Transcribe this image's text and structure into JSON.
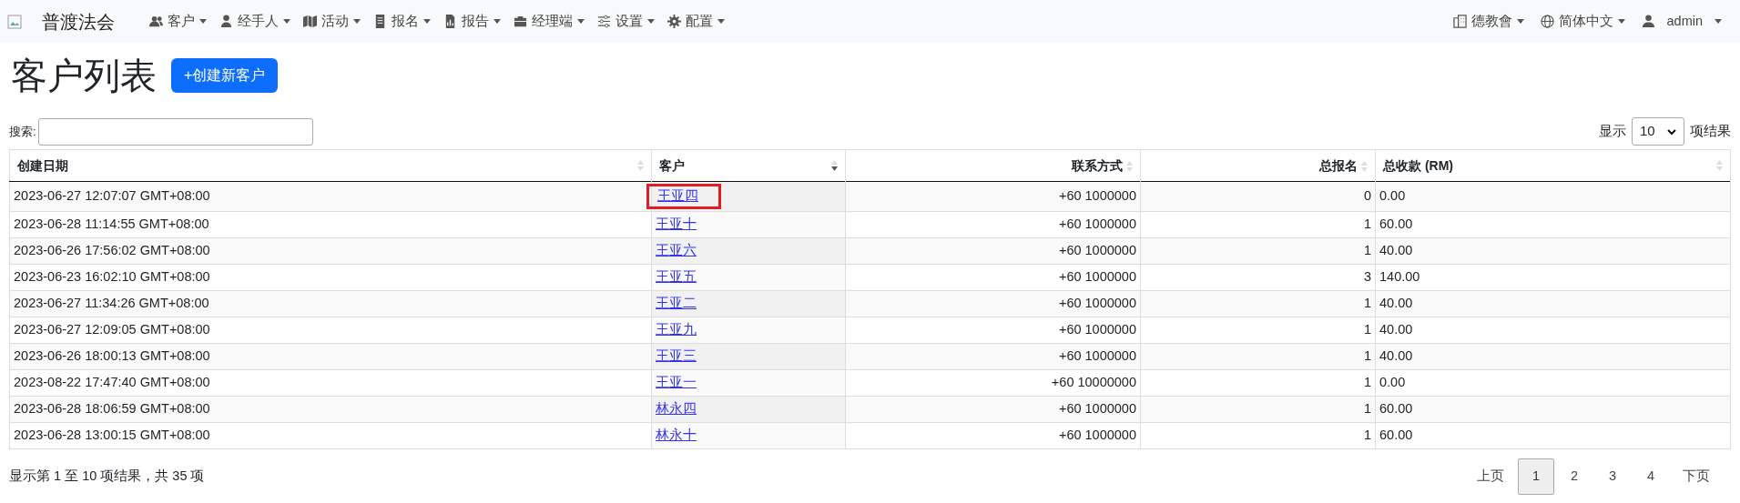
{
  "navbar": {
    "brand": "普渡法会",
    "menu": [
      {
        "label": "客户"
      },
      {
        "label": "经手人"
      },
      {
        "label": "活动"
      },
      {
        "label": "报名"
      },
      {
        "label": "报告"
      },
      {
        "label": "经理端"
      },
      {
        "label": "设置"
      },
      {
        "label": "配置"
      }
    ],
    "right": [
      {
        "label": "德教會"
      },
      {
        "label": "简体中文"
      },
      {
        "label": "admin"
      }
    ]
  },
  "page_title": "客户列表",
  "create_button": "+创建新客户",
  "search": {
    "label": "搜索:"
  },
  "length": {
    "before": "显示",
    "value": "10",
    "after": "项结果"
  },
  "table": {
    "columns": [
      {
        "label": "创建日期",
        "sorted": false
      },
      {
        "label": "客户",
        "sorted": true
      },
      {
        "label": "联系方式",
        "sorted": false
      },
      {
        "label": "总报名",
        "sorted": false
      },
      {
        "label": "总收款 (RM)",
        "sorted": false
      }
    ],
    "rows": [
      {
        "date": "2023-06-27 12:07:07 GMT+08:00",
        "customer": "王亚四",
        "contact": "+60 1000000",
        "signups": "0",
        "paid": "0.00",
        "highlighted": true
      },
      {
        "date": "2023-06-28 11:14:55 GMT+08:00",
        "customer": "王亚十",
        "contact": "+60 1000000",
        "signups": "1",
        "paid": "60.00",
        "highlighted": false
      },
      {
        "date": "2023-06-26 17:56:02 GMT+08:00",
        "customer": "王亚六",
        "contact": "+60 1000000",
        "signups": "1",
        "paid": "40.00",
        "highlighted": false
      },
      {
        "date": "2023-06-23 16:02:10 GMT+08:00",
        "customer": "王亚五",
        "contact": "+60 1000000",
        "signups": "3",
        "paid": "140.00",
        "highlighted": false
      },
      {
        "date": "2023-06-27 11:34:26 GMT+08:00",
        "customer": "王亚二",
        "contact": "+60 1000000",
        "signups": "1",
        "paid": "40.00",
        "highlighted": false
      },
      {
        "date": "2023-06-27 12:09:05 GMT+08:00",
        "customer": "王亚九",
        "contact": "+60 1000000",
        "signups": "1",
        "paid": "40.00",
        "highlighted": false
      },
      {
        "date": "2023-06-26 18:00:13 GMT+08:00",
        "customer": "王亚三",
        "contact": "+60 1000000",
        "signups": "1",
        "paid": "40.00",
        "highlighted": false
      },
      {
        "date": "2023-08-22 17:47:40 GMT+08:00",
        "customer": "王亚一",
        "contact": "+60 10000000",
        "signups": "1",
        "paid": "0.00",
        "highlighted": false
      },
      {
        "date": "2023-06-28 18:06:59 GMT+08:00",
        "customer": "林永四",
        "contact": "+60 1000000",
        "signups": "1",
        "paid": "60.00",
        "highlighted": false
      },
      {
        "date": "2023-06-28 13:00:15 GMT+08:00",
        "customer": "林永十",
        "contact": "+60 1000000",
        "signups": "1",
        "paid": "60.00",
        "highlighted": false
      }
    ]
  },
  "info": "显示第 1 至 10 项结果，共 35 项",
  "pagination": [
    {
      "label": "上页",
      "selected": false
    },
    {
      "label": "1",
      "selected": true
    },
    {
      "label": "2",
      "selected": false
    },
    {
      "label": "3",
      "selected": false
    },
    {
      "label": "4",
      "selected": false
    },
    {
      "label": "下页",
      "selected": false
    }
  ]
}
